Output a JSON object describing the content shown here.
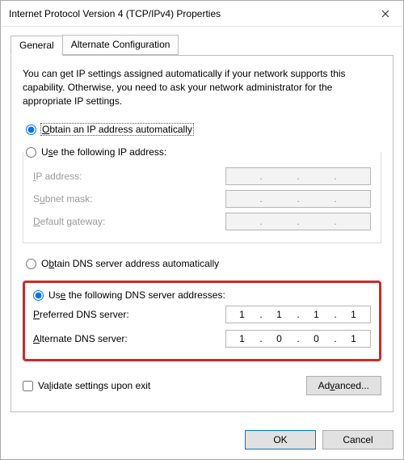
{
  "window": {
    "title": "Internet Protocol Version 4 (TCP/IPv4) Properties"
  },
  "tabs": {
    "general": "General",
    "alternate": "Alternate Configuration"
  },
  "description": "You can get IP settings assigned automatically if your network supports this capability. Otherwise, you need to ask your network administrator for the appropriate IP settings.",
  "ip": {
    "auto_label": "Obtain an IP address automatically",
    "manual_label": "Use the following IP address:",
    "ip_label": "IP address:",
    "subnet_label": "Subnet mask:",
    "gateway_label": "Default gateway:",
    "ip_value": [
      "",
      "",
      "",
      ""
    ],
    "subnet_value": [
      "",
      "",
      "",
      ""
    ],
    "gateway_value": [
      "",
      "",
      "",
      ""
    ],
    "selected": "auto"
  },
  "dns": {
    "auto_label": "Obtain DNS server address automatically",
    "manual_label": "Use the following DNS server addresses:",
    "preferred_label": "Preferred DNS server:",
    "alternate_label": "Alternate DNS server:",
    "preferred_value": [
      "1",
      "1",
      "1",
      "1"
    ],
    "alternate_value": [
      "1",
      "0",
      "0",
      "1"
    ],
    "selected": "manual"
  },
  "validate_label": "Validate settings upon exit",
  "buttons": {
    "advanced": "Advanced...",
    "ok": "OK",
    "cancel": "Cancel"
  }
}
